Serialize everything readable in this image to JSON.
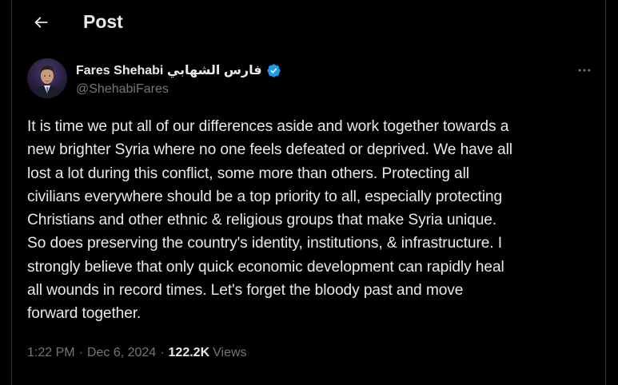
{
  "header": {
    "title": "Post",
    "back_icon": "arrow-left-icon"
  },
  "author": {
    "display_name": "Fares Shehabi فارس الشهابي",
    "handle": "@ShehabiFares",
    "verified_icon": "verified-badge-icon",
    "verified_color": "#1d9bf0"
  },
  "more_icon": "more-horizontal-icon",
  "tweet": {
    "lines": [
      "It is time we put all of our differences aside and work together towards a",
      "new brighter Syria where no one feels defeated or deprived. We have all",
      "lost a lot during this conflict, some more than others. Protecting all",
      "civilians everywhere should be a top priority to all, especially protecting",
      "Christians and other ethnic & religious groups that make Syria unique.",
      "So does preserving the country's identity, institutions, & infrastructure. I",
      "strongly believe that only quick economic development can rapidly heal",
      "all wounds in record times. Let's forget the bloody past and move",
      "forward together."
    ]
  },
  "meta": {
    "time": "1:22 PM",
    "separator": "·",
    "date": "Dec 6, 2024",
    "views_count": "122.2K",
    "views_label": "Views"
  },
  "colors": {
    "background": "#000000",
    "text_primary": "#e7e9ea",
    "text_secondary": "#71767b",
    "border": "#2f3336",
    "accent": "#1d9bf0"
  }
}
